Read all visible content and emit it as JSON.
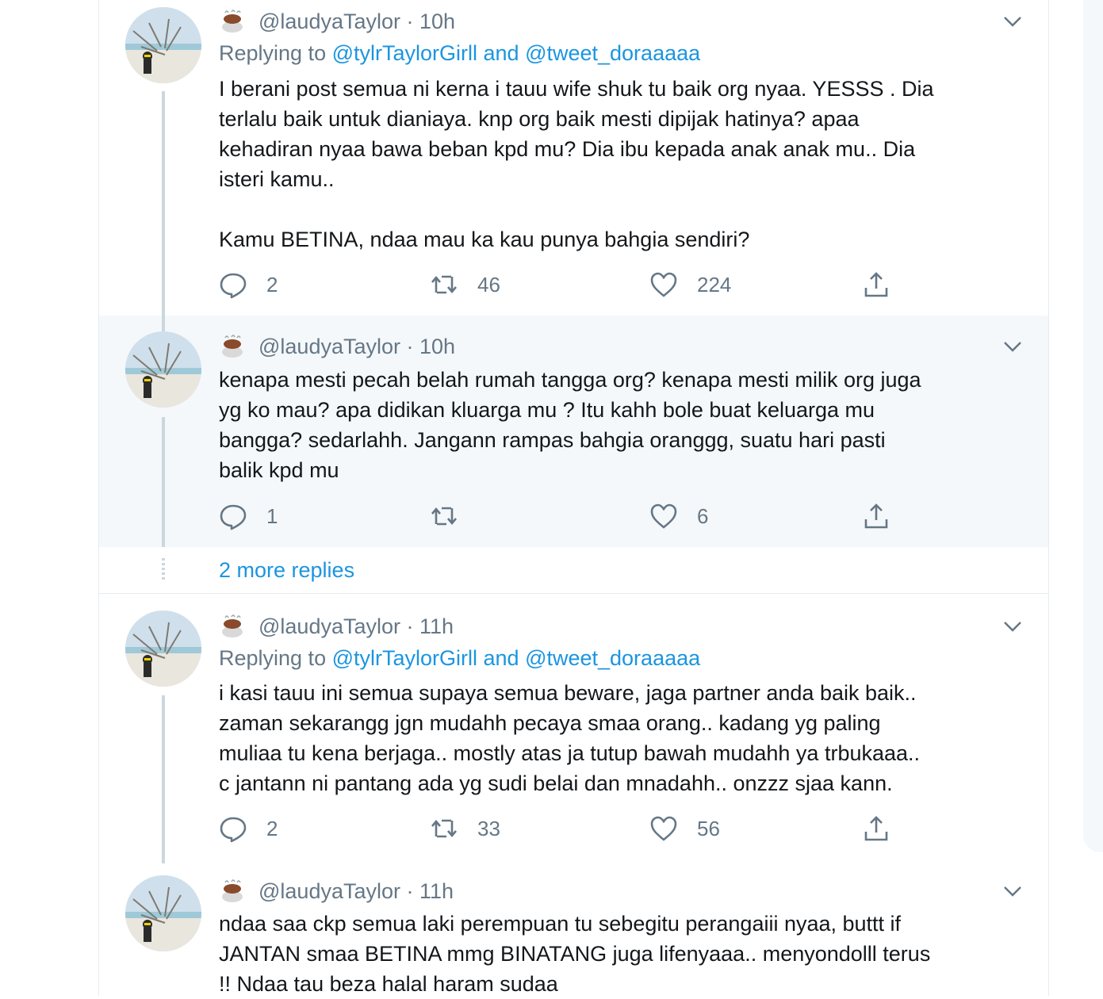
{
  "tweets": [
    {
      "handle": "@laudyaTaylor",
      "time": "· 10h",
      "replying_prefix": "Replying to",
      "replying_users": "@tylrTaylorGirll and @tweet_doraaaaa",
      "text": "I berani post semua ni kerna i tauu wife shuk tu baik org nyaa. YESSS . Dia\nterlalu baik untuk dianiaya. knp org baik mesti dipijak hatinya? apaa\nkehadiran nyaa bawa beban kpd mu? Dia ibu kepada anak anak mu.. Dia\nisteri kamu..\n\nKamu BETINA, ndaa mau ka kau punya bahgia sendiri?",
      "replies": "2",
      "retweets": "46",
      "likes": "224"
    },
    {
      "handle": "@laudyaTaylor",
      "time": "· 10h",
      "text": "kenapa mesti pecah belah rumah tangga org? kenapa mesti milik org juga\nyg ko mau? apa didikan kluarga mu ? Itu kahh bole buat keluarga mu\nbangga? sedarlahh. Jangann rampas bahgia oranggg, suatu hari pasti\nbalik kpd mu",
      "replies": "1",
      "retweets": "",
      "likes": "6"
    },
    {
      "handle": "@laudyaTaylor",
      "time": "· 11h",
      "replying_prefix": "Replying to",
      "replying_users": "@tylrTaylorGirll and @tweet_doraaaaa",
      "text": "i kasi tauu ini semua supaya semua beware, jaga partner anda  baik baik..\nzaman sekarangg jgn mudahh pecaya smaa orang.. kadang yg paling\nmuliaa tu kena berjaga.. mostly atas ja tutup bawah mudahh ya trbukaaa..\nc jantann ni pantang ada yg sudi belai dan mnadahh.. onzzz sjaa kann.",
      "replies": "2",
      "retweets": "33",
      "likes": "56"
    },
    {
      "handle": "@laudyaTaylor",
      "time": "· 11h",
      "text": "ndaa saa ckp semua laki perempuan tu sebegitu perangaiii nyaa, buttt if\nJANTAN smaa BETINA mmg BINATANG juga lifenyaaa.. menyondolll terus\n!! Ndaa tau beza halal haram sudaa"
    }
  ],
  "more_replies": "2 more replies",
  "colors": {
    "link": "#1b95e0",
    "muted": "#657786",
    "highlight_bg": "#f5f8fa",
    "thread_line": "#ccd6dd"
  },
  "icons": [
    "coffee-emoji-icon",
    "chevron-down-icon",
    "reply-icon",
    "retweet-icon",
    "like-icon",
    "share-icon"
  ]
}
